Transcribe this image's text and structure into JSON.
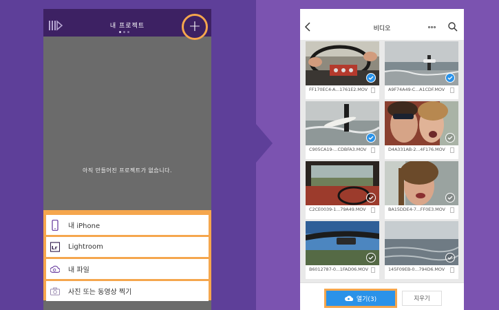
{
  "left": {
    "title": "내 프로젝트",
    "add_label": "+",
    "empty_message": "아직 만들어진 프로젝트가 없습니다.",
    "menu": [
      {
        "label": "내 iPhone",
        "icon": "phone-icon"
      },
      {
        "label": "Lightroom",
        "icon": "lightroom-icon"
      },
      {
        "label": "내 파일",
        "icon": "creative-cloud-icon"
      },
      {
        "label": "사진 또는 동영상 찍기",
        "icon": "camera-icon"
      }
    ]
  },
  "right": {
    "title": "비디오",
    "items": [
      {
        "name": "FF170EC4-A...1761E2.MOV",
        "selected": true
      },
      {
        "name": "A9F74A49-C...A1CDF.MOV",
        "selected": true
      },
      {
        "name": "C905CA19-...CDBFA3.MOV",
        "selected": true
      },
      {
        "name": "D4A331AB-2...4F176.MOV",
        "selected": false
      },
      {
        "name": "C2CE0039-1...79A49.MOV",
        "selected": false
      },
      {
        "name": "BA15DDE4-7...FF0E3.MOV",
        "selected": false
      },
      {
        "name": "B6012787-0...1FAD06.MOV",
        "selected": false
      },
      {
        "name": "145F09EB-0...794D6.MOV",
        "selected": false
      }
    ],
    "open_label": "열기(3)",
    "clear_label": "지우기"
  },
  "colors": {
    "accent": "#f5a64d",
    "primary_blue": "#2a92e8",
    "header_purple": "#3d2163"
  }
}
